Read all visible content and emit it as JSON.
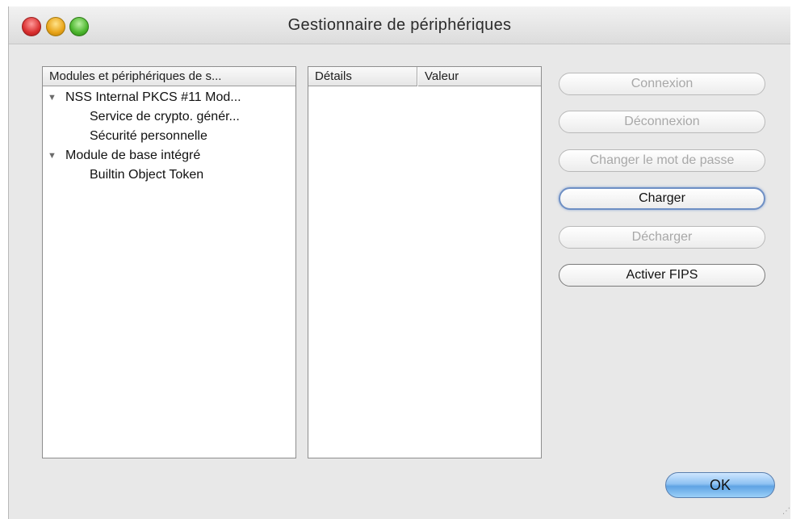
{
  "window": {
    "title": "Gestionnaire de périphériques"
  },
  "tree": {
    "header": "Modules et périphériques de s...",
    "items": [
      {
        "label": "NSS Internal PKCS #11 Mod...",
        "level": 0,
        "expanded": true
      },
      {
        "label": "Service de crypto. génér...",
        "level": 1
      },
      {
        "label": "Sécurité personnelle",
        "level": 1
      },
      {
        "label": "Module de base intégré",
        "level": 0,
        "expanded": true
      },
      {
        "label": "Builtin Object Token",
        "level": 1
      }
    ]
  },
  "details": {
    "col_details": "Détails",
    "col_value": "Valeur"
  },
  "buttons": {
    "connexion": "Connexion",
    "deconnexion": "Déconnexion",
    "change_password": "Changer le mot de passe",
    "load": "Charger",
    "unload": "Décharger",
    "enable_fips": "Activer FIPS",
    "ok": "OK"
  },
  "icons": {
    "close": "close-icon",
    "minimize": "minimize-icon",
    "zoom": "zoom-icon",
    "disclosure": "triangle-down-icon"
  },
  "colors": {
    "ok_button": "#6aaee8",
    "focus_ring": "#6e8fc4",
    "disabled_text": "#a8a8a8"
  }
}
